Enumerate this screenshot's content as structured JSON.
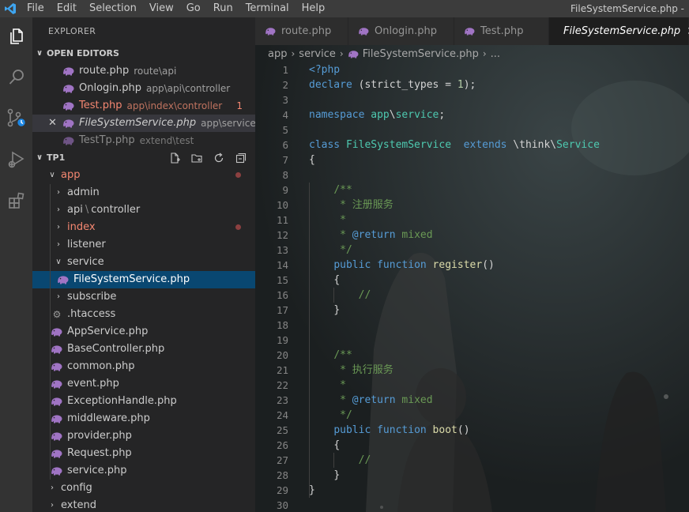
{
  "window": {
    "title": "FileSystemService.php -",
    "menu": [
      "File",
      "Edit",
      "Selection",
      "View",
      "Go",
      "Run",
      "Terminal",
      "Help"
    ]
  },
  "explorer": {
    "title": "EXPLORER",
    "open_editors": {
      "header": "OPEN EDITORS",
      "items": [
        {
          "name": "route.php",
          "desc": "route\\api"
        },
        {
          "name": "Onlogin.php",
          "desc": "app\\api\\controller"
        },
        {
          "name": "Test.php",
          "desc": "app\\index\\controller",
          "badge": "1"
        },
        {
          "name": "FileSystemService.php",
          "desc": "app\\service",
          "close": "✕"
        },
        {
          "name": "TestTp.php",
          "desc": "extend\\test"
        }
      ]
    },
    "project": {
      "header": "TP1",
      "tree": [
        {
          "name": "app"
        },
        {
          "name": "admin"
        },
        {
          "name": "api",
          "name2": "controller",
          "sep": "\\"
        },
        {
          "name": "index"
        },
        {
          "name": "listener"
        },
        {
          "name": "service"
        },
        {
          "name": "FileSystemService.php"
        },
        {
          "name": "subscribe"
        },
        {
          "name": ".htaccess"
        },
        {
          "name": "AppService.php"
        },
        {
          "name": "BaseController.php"
        },
        {
          "name": "common.php"
        },
        {
          "name": "event.php"
        },
        {
          "name": "ExceptionHandle.php"
        },
        {
          "name": "middleware.php"
        },
        {
          "name": "provider.php"
        },
        {
          "name": "Request.php"
        },
        {
          "name": "service.php"
        },
        {
          "name": "config"
        },
        {
          "name": "extend"
        }
      ]
    }
  },
  "tabs": [
    {
      "label": "route.php"
    },
    {
      "label": "Onlogin.php"
    },
    {
      "label": "Test.php"
    },
    {
      "label": "FileSystemService.php",
      "close": "✕"
    }
  ],
  "breadcrumb": [
    "app",
    "service",
    "FileSystemService.php",
    "..."
  ],
  "code": {
    "line_numbers": [
      "1",
      "2",
      "3",
      "4",
      "5",
      "6",
      "7",
      "8",
      "9",
      "10",
      "11",
      "12",
      "13",
      "14",
      "15",
      "16",
      "17",
      "18",
      "19",
      "20",
      "21",
      "22",
      "23",
      "24",
      "25",
      "26",
      "27",
      "28",
      "29",
      "30"
    ],
    "l1": "<?php",
    "l2_kw": "declare",
    "l2_rest": " (strict_types = ",
    "l2_num": "1",
    "l2_end": ");",
    "l4_kw": "namespace",
    "l4_ns1": " app",
    "l4_sep": "\\",
    "l4_ns2": "service",
    "l4_end": ";",
    "l6_kw": "class",
    "l6_cls": " FileSystemService ",
    "l6_ext": " extends",
    "l6_sep": " \\think\\",
    "l6_parent": "Service",
    "l7": "{",
    "l9": "/**",
    "l10": " * 注册服务",
    "l11": " *",
    "l12_a": " * ",
    "l12_tag": "@return",
    "l12_b": " mixed",
    "l13": " */",
    "l14_kw1": "public",
    "l14_kw2": " function",
    "l14_fn": " register",
    "l14_end": "()",
    "l15": "{",
    "l16": "//",
    "l17": "}",
    "l20": "/**",
    "l21": " * 执行服务",
    "l22": " *",
    "l23_a": " * ",
    "l23_tag": "@return",
    "l23_b": " mixed",
    "l24": " */",
    "l25_kw1": "public",
    "l25_kw2": " function",
    "l25_fn": " boot",
    "l25_end": "()",
    "l26": "{",
    "l27": "//",
    "l28": "}",
    "l29": "}"
  },
  "colors": {
    "accent": "#007acc",
    "selection": "#094771",
    "error": "#f48771",
    "php_icon": "#a074c4"
  }
}
